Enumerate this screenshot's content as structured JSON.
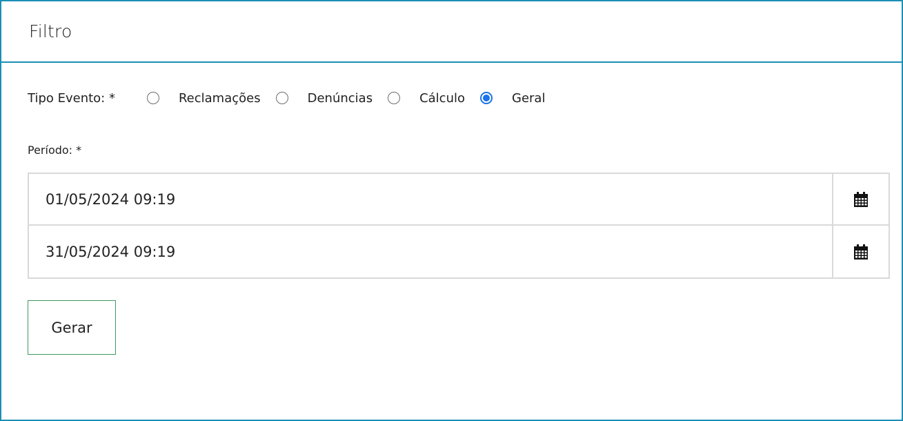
{
  "panel": {
    "title": "Filtro"
  },
  "tipo_evento": {
    "label": "Tipo Evento: *",
    "options": [
      {
        "label": "Reclamações",
        "checked": false
      },
      {
        "label": "Denúncias",
        "checked": false
      },
      {
        "label": "Cálculo",
        "checked": false
      },
      {
        "label": "Geral",
        "checked": true
      }
    ],
    "radio_accent": "#1a73e8"
  },
  "periodo": {
    "label": "Período: *",
    "start": "01/05/2024 09:19",
    "end": "31/05/2024 09:19",
    "calendar_icon": "calendar-icon"
  },
  "actions": {
    "generate_label": "Gerar"
  },
  "colors": {
    "panel_border": "#1a8fb5",
    "button_border": "#3c9a5f"
  }
}
